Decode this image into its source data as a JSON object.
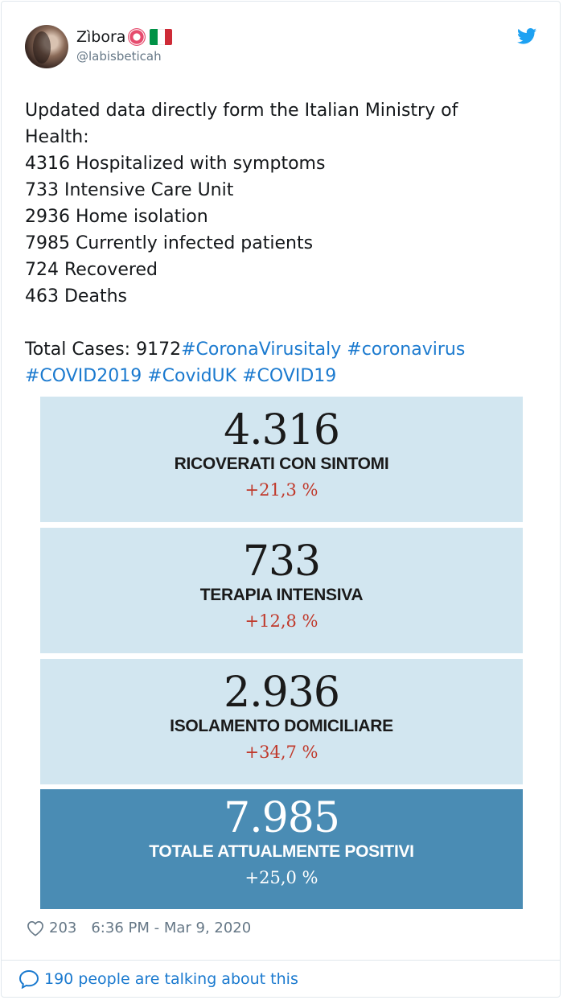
{
  "user": {
    "display_name": "Zìbora",
    "handle": "@labisbeticah",
    "badge_icon": "flower-icon",
    "flag_icon": "italy-flag-icon",
    "flag_colors": [
      "#009246",
      "#ffffff",
      "#ce2b37"
    ]
  },
  "tweet": {
    "lines": [
      "Updated data directly form the Italian Ministry of",
      "Health:",
      "4316 Hospitalized with symptoms",
      "733 Intensive Care Unit",
      "2936 Home isolation",
      "7985 Currently infected patients",
      "724 Recovered",
      "463 Deaths"
    ],
    "total_prefix": "Total Cases: 9172",
    "hashtags_line1": [
      "#CoronaVirusitaly",
      "#coronavirus"
    ],
    "hashtags_line2": [
      "#COVID2019",
      "#CovidUK",
      "#COVID19"
    ]
  },
  "media": {
    "panels": [
      {
        "value": "4.316",
        "label": "RICOVERATI CON SINTOMI",
        "change": "+21,3 %"
      },
      {
        "value": "733",
        "label": "TERAPIA INTENSIVA",
        "change": "+12,8 %"
      },
      {
        "value": "2.936",
        "label": "ISOLAMENTO DOMICILIARE",
        "change": "+34,7 %"
      },
      {
        "value": "7.985",
        "label": "TOTALE ATTUALMENTE POSITIVI",
        "change": "+25,0 %"
      }
    ],
    "colors": {
      "light": "#d2e6f0",
      "dark": "#4a8cb4",
      "change_red": "#c0392b"
    }
  },
  "meta": {
    "likes": "203",
    "timestamp": "6:36 PM - Mar 9, 2020"
  },
  "footer": {
    "conversation": "190 people are talking about this"
  },
  "colors": {
    "link": "#1b7acf",
    "twitter_blue": "#1da1f2",
    "muted": "#657786"
  }
}
